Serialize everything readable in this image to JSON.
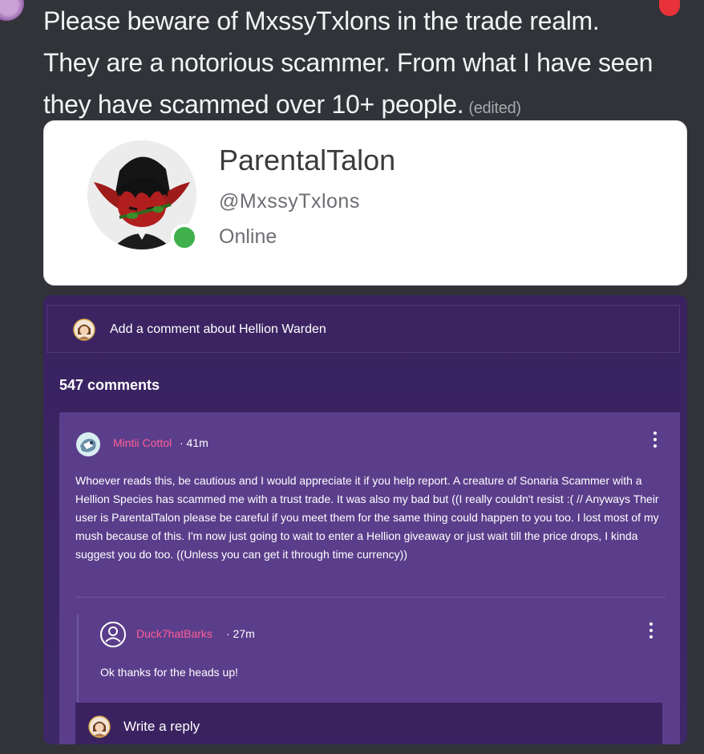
{
  "message": {
    "line1": "Please beware of MxssyTxlons in the trade realm.",
    "line2": "They are a notorious scammer. From what I have seen",
    "line3": "they have scammed over 10+ people.",
    "edited": "(edited)"
  },
  "profile": {
    "display_name": "ParentalTalon",
    "handle": "@MxssyTxlons",
    "presence": "Online",
    "status_color": "#3fb04b"
  },
  "comments_section": {
    "add_comment_placeholder": "Add a comment about Hellion Warden",
    "count_label": "547 comments",
    "comment": {
      "username": "Mintii Cottol",
      "time": "· 41m",
      "body": "Whoever reads this, be cautious and I would appreciate it if you help report. A creature of Sonaria Scammer with a Hellion Species has scammed me with a trust trade. It was also my bad but ((I really couldn't resist :( // Anyways Their user is ParentalTalon please be careful if you meet them for the same thing could happen to you too. I lost most of my mush because of this. I'm now just going to wait to enter a Hellion giveaway or just wait till the price drops, I kinda suggest you do too. ((Unless you can get it through time currency))"
    },
    "reply": {
      "username": "Duck7hatBarks",
      "time": "· 27m",
      "body": "Ok thanks for the heads up!"
    },
    "write_reply_label": "Write a reply"
  },
  "colors": {
    "background": "#313338",
    "panel": "#3a2260",
    "comment_card": "#5b3e8b",
    "username_accent": "#ff5e96"
  }
}
